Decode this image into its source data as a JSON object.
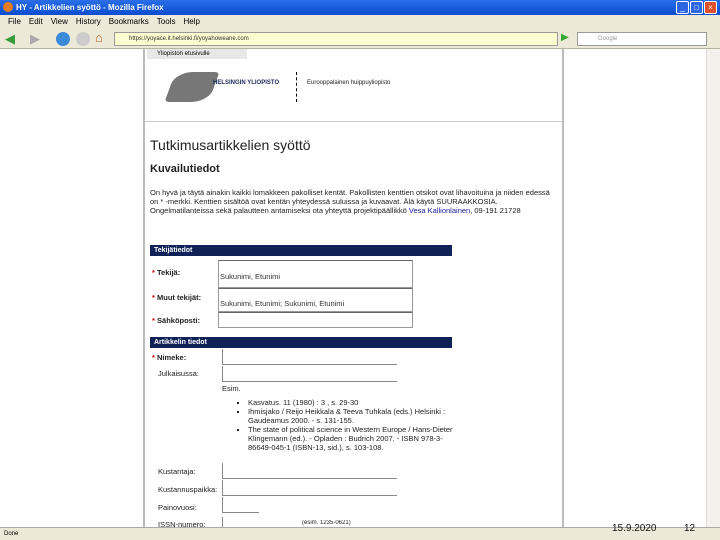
{
  "window": {
    "title": "HY - Artikkelien syöttö - Mozilla Firefox"
  },
  "menu": [
    "File",
    "Edit",
    "View",
    "History",
    "Bookmarks",
    "Tools",
    "Help"
  ],
  "nav": {
    "url": "https://yoyace.it.helsinki.fi/yoyahoweane.com",
    "search_placeholder": "Google"
  },
  "site": {
    "tab": "Yliopiston etusivulle",
    "university": "HELSINGIN YLIOPISTO",
    "tagline": "Eurooppalainen huippuyliopisto"
  },
  "form": {
    "title": "Tutkimusartikkelien syöttö",
    "subtitle": "Kuvailutiedot",
    "intro": "On hyvä ja täytä ainakin kaikki lomakkeen pakolliset kentät. Pakollisten kenttien otsikot ovat lihavoituina ja niiden edessä on * -merkki. Kenttien sisältöä ovat kentän yhteydessä suluissa ja kuvaavat. Älä käytä SUURAAKKOSIA. Ongelmatilanteissa sekä palautteen antamiseksi ota yhteyttä projektipäällikkö",
    "contact_link": "Vesa Kallionlainen",
    "contact_phone": ", 09-191 21728",
    "section1": "Tekijätiedot",
    "author_label": "Tekijä:",
    "author_value": "Sukunimi, Etunimi",
    "other_authors_label": "Muut tekijät:",
    "other_authors_value": "Sukunimi, Etunimi; Sukunimi, Etunimi",
    "email_label": "Sähköposti:",
    "section2": "Artikkelin tiedot",
    "title_label": "Nimeke:",
    "published_in_label": "Julkaisussa:",
    "example_label": "Esim.",
    "examples": [
      "Kasvatus. 11 (1980) : 3 , s. 29-30",
      "Ihmisjako / Reijo Heikkala & Teeva Tuhkala (eds.) Helsinki : Gaudeamus 2000. - s. 131-155.",
      "The state of political science in Western Europe / Hans-Dieter Klingemann (ed.). - Opladen : Budrich 2007. - ISBN 978-3-86649-045-1 (ISBN-13, sid.), s. 103-108."
    ],
    "publisher_label": "Kustantaja:",
    "place_label": "Kustannuspaikka:",
    "year_label": "Painovuosi:",
    "issn_label": "ISSN-numero:",
    "issn_hint": "(esim. 1235-0621)",
    "required_mark": "*"
  },
  "status": {
    "left": "Done",
    "date": "15.9.2020",
    "page": "12"
  }
}
